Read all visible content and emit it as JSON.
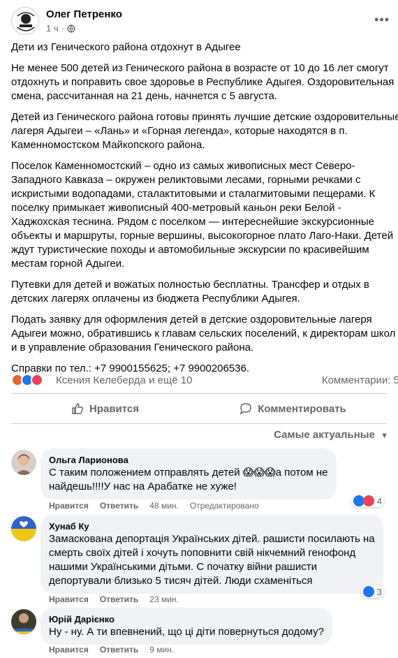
{
  "post": {
    "author": "Олег Петренко",
    "time": "1 ч",
    "paragraphs": [
      [
        "Дети из Генического района отдохнут в Адыгее"
      ],
      [
        "Не менее 500 детей из Генического района в возрасте от 10 до 16 лет смогут",
        "отдохнуть и поправить свое здоровье в Республике Адыгея. Оздоровительная",
        "смена, рассчитанная на 21 день, начнется с 5 августа."
      ],
      [
        "Детей из Генического района готовы принять лучшие детские оздоровительные",
        "лагеря Адыгеи – «Лань» и «Горная легенда», которые находятся в п.",
        "Каменномостском Майкопского района."
      ],
      [
        "Поселок Каменномостский – одно из самых живописных мест Северо-",
        "Западного Кавказа – окружен реликтовыми лесами, горными речками с",
        "искристыми водопадами, сталактитовыми и сталагмитовыми пещерами. К",
        "поселку примыкает живописный 400-метровый каньон реки Белой -",
        "Хаджохская теснина. Рядом с поселком — интереснейшие экскурсионные",
        "объекты и маршруты, горные вершины, высокогорное плато Лаго-Наки. Детей",
        "ждут туристические походы и автомобильные экскурсии по красивейшим",
        "местам горной Адыгеи."
      ],
      [
        "Путевки для детей и вожатых полностью бесплатны. Трансфер и отдых в",
        "детских лагерях оплачены из бюджета Республики Адыгея."
      ],
      [
        "Подать заявку для оформления детей в детские оздоровительные лагеря",
        "Адыгеи можно, обратившись к главам сельских поселений, к директорам школ",
        "и в управление образования Генического района."
      ],
      [
        "Справки по тел.: +7 9900155625; +7 9900206536."
      ]
    ],
    "reactions_text": "Ксения Келеберда и ещё 10",
    "comments_count": "Комментарии: 5",
    "like_label": "Нравится",
    "comment_label": "Комментировать",
    "sort_label": "Самые актуальные"
  },
  "comments": [
    {
      "name": "Ольга Ларионова",
      "lines": [
        "С таким положением отправлять детей 😱😱😱а потом не",
        "найдешь!!!!У нас на Арабатке не хуже!"
      ],
      "like": "Нравится",
      "reply": "Ответить",
      "time": "48 мин.",
      "edited": "Отредактировано",
      "reaction_count": "4"
    },
    {
      "name": "Хунаб Ку",
      "lines": [
        "Замаскована депортація Українських дітей. рашисти посилають на",
        "смерть своїх дітей і хочуть поповнити свій нікчемний генофонд",
        "нашими Українськими дітьми. С початку війни рашисти",
        "депортували близько 5 тисяч дітей. Люди схаменіться"
      ],
      "like": "Нравится",
      "reply": "Ответить",
      "time": "23 мин.",
      "reaction_count": "3"
    },
    {
      "name": "Юрій Дарієнко",
      "lines": [
        "Ну - ну. А ти впевнений, що ці діти повернуться додому?"
      ],
      "like": "Нравится",
      "reply": "Ответить",
      "time": "9 мин."
    }
  ],
  "icons": {
    "globe": "globe-icon",
    "more": "more-dots-icon",
    "like": "thumbs-up-icon",
    "comment": "comment-bubble-icon",
    "chevron": "chevron-down-icon"
  },
  "colors": {
    "accent": "#1877f2",
    "secondary_text": "#65676b",
    "bubble_bg": "#f0f2f5"
  }
}
